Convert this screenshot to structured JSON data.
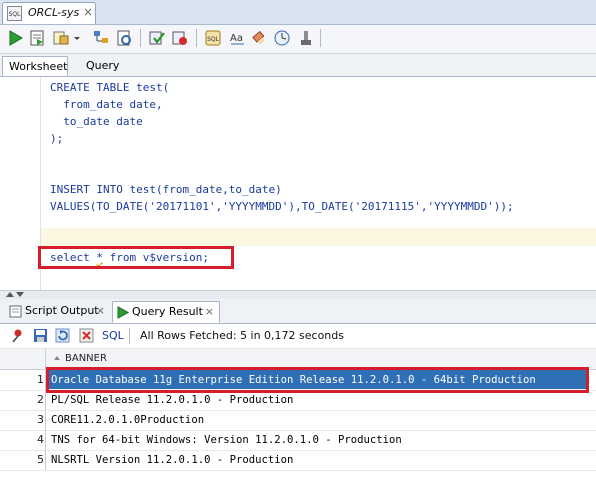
{
  "doc_tab": {
    "sql_badge": "SQL",
    "title": "ORCL-sys"
  },
  "toolbar": {
    "buttons": [
      "run-statement",
      "run-script",
      "autotrace",
      "explain-plan",
      "sql-tuning",
      "commit",
      "rollback",
      "unshared-sql",
      "format",
      "clear",
      "history",
      "tools"
    ]
  },
  "worksheet_tabs": [
    {
      "label": "Worksheet"
    },
    {
      "label": "Query Builder"
    }
  ],
  "editor": {
    "lines": [
      "CREATE TABLE test(",
      "  from_date date,",
      "  to_date date",
      ");",
      "",
      "",
      "INSERT INTO test(from_date,to_date)",
      "VALUES(TO_DATE('20171101','YYYYMMDD'),TO_DATE('20171115','YYYYMMDD'));",
      "",
      "",
      "select * from v$version;"
    ],
    "select_prefix": "select ",
    "select_star": "*",
    "select_suffix": " from v$version;"
  },
  "output_tabs": [
    {
      "label": "Script Output",
      "icon": "script-output-icon"
    },
    {
      "label": "Query Result",
      "icon": "query-result-icon"
    }
  ],
  "result_toolbar": {
    "sql_label": "SQL",
    "status": "All Rows Fetched: 5 in 0,172 seconds"
  },
  "grid": {
    "column": "BANNER",
    "rows": [
      {
        "n": "1",
        "banner": "Oracle Database 11g Enterprise Edition Release 11.2.0.1.0 - 64bit Production"
      },
      {
        "n": "2",
        "banner": "PL/SQL Release 11.2.0.1.0 - Production"
      },
      {
        "n": "3",
        "banner": "CORE11.2.0.1.0Production"
      },
      {
        "n": "4",
        "banner": "TNS for 64-bit Windows: Version 11.2.0.1.0 - Production"
      },
      {
        "n": "5",
        "banner": "NLSRTL Version 11.2.0.1.0 - Production"
      }
    ]
  },
  "colors": {
    "highlight_box": "#d71c2b",
    "selection": "#2f6fb5",
    "keyword": "#1a3aa0"
  }
}
